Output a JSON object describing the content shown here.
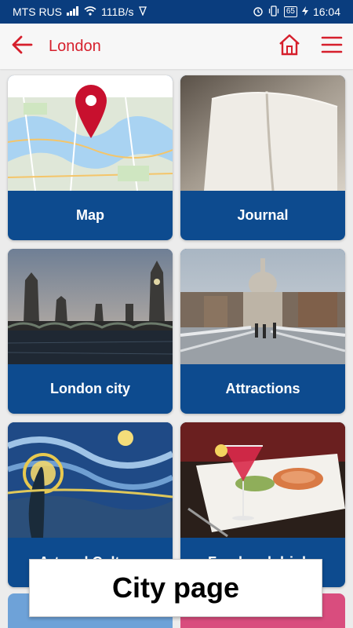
{
  "status_bar": {
    "carrier": "MTS RUS",
    "speed": "111B/s",
    "battery": "65",
    "time": "16:04"
  },
  "app_bar": {
    "title": "London",
    "back_icon": "arrow-left-icon",
    "home_icon": "home-icon",
    "menu_icon": "menu-icon"
  },
  "cards": [
    {
      "label": "Map",
      "image": "map-image"
    },
    {
      "label": "Journal",
      "image": "journal-image"
    },
    {
      "label": "London city",
      "image": "london-city-image"
    },
    {
      "label": "Attractions",
      "image": "attractions-image"
    },
    {
      "label": "Art and Culture",
      "image": "art-image"
    },
    {
      "label": "Food and drinks",
      "image": "food-image"
    }
  ],
  "caption": "City page",
  "colors": {
    "accent": "#d61f2c",
    "card": "#0d4b8f",
    "status_bar": "#0a3d7e"
  }
}
